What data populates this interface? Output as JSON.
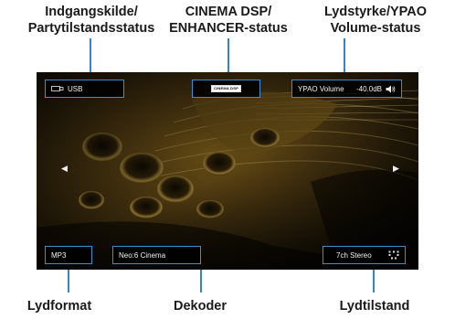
{
  "callouts": {
    "input": [
      "Indgangskilde/",
      "Partytilstandsstatus"
    ],
    "dsp": [
      "CINEMA DSP/",
      "ENHANCER-status"
    ],
    "volume": [
      "Lydstyrke/YPAO",
      "Volume-status"
    ],
    "audio_format": "Lydformat",
    "decoder": "Dekoder",
    "sound_mode": "Lydtilstand"
  },
  "screen": {
    "input_source": "USB",
    "dsp_logo_text": "CINEMA DSP",
    "ypao_label": "YPAO Volume",
    "volume_value": "-40.0dB",
    "audio_format": "MP3",
    "decoder": "Neo:6 Cinema",
    "sound_mode": "7ch Stereo"
  },
  "icons": {
    "input": "usb-input-icon",
    "volume": "speaker-volume-icon",
    "sound_mode": "surround-speakers-icon",
    "left": "left-arrow-icon",
    "right": "right-arrow-icon"
  },
  "colors": {
    "accent": "#2f86c8",
    "badge_border": "#3a8fd0"
  }
}
